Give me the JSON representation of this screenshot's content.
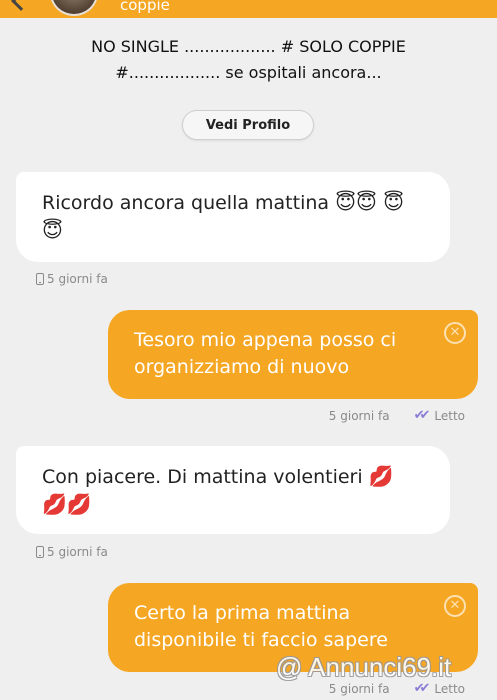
{
  "header": {
    "subtitle": "coppie"
  },
  "profile": {
    "bio_line1": "NO SINGLE .................. # SOLO COPPIE",
    "bio_line2": "#.................. se ospitali ancora...",
    "view_profile_label": "Vedi Profilo"
  },
  "messages": [
    {
      "direction": "incoming",
      "text": "Ricordo ancora quella mattina",
      "emoji": "😇😇 😇😇",
      "time": "5 giorni fa",
      "icon": "phone-icon"
    },
    {
      "direction": "outgoing",
      "text": "Tesoro mio appena posso ci organizziamo di nuovo",
      "time": "5 giorni fa",
      "status": "Letto",
      "icon": "double-check-icon"
    },
    {
      "direction": "incoming",
      "text": "Con piacere. Di mattina volentieri",
      "emoji": "💋 💋💋",
      "time": "5 giorni fa",
      "icon": "phone-icon"
    },
    {
      "direction": "outgoing",
      "text": "Certo la prima mattina disponibile ti faccio sapere",
      "time": "5 giorni fa",
      "status": "Letto",
      "icon": "double-check-icon"
    }
  ],
  "watermark": "@ Annunci69.it",
  "colors": {
    "accent": "#f5a623",
    "background": "#efefef",
    "read_check": "#8b7ad6"
  }
}
